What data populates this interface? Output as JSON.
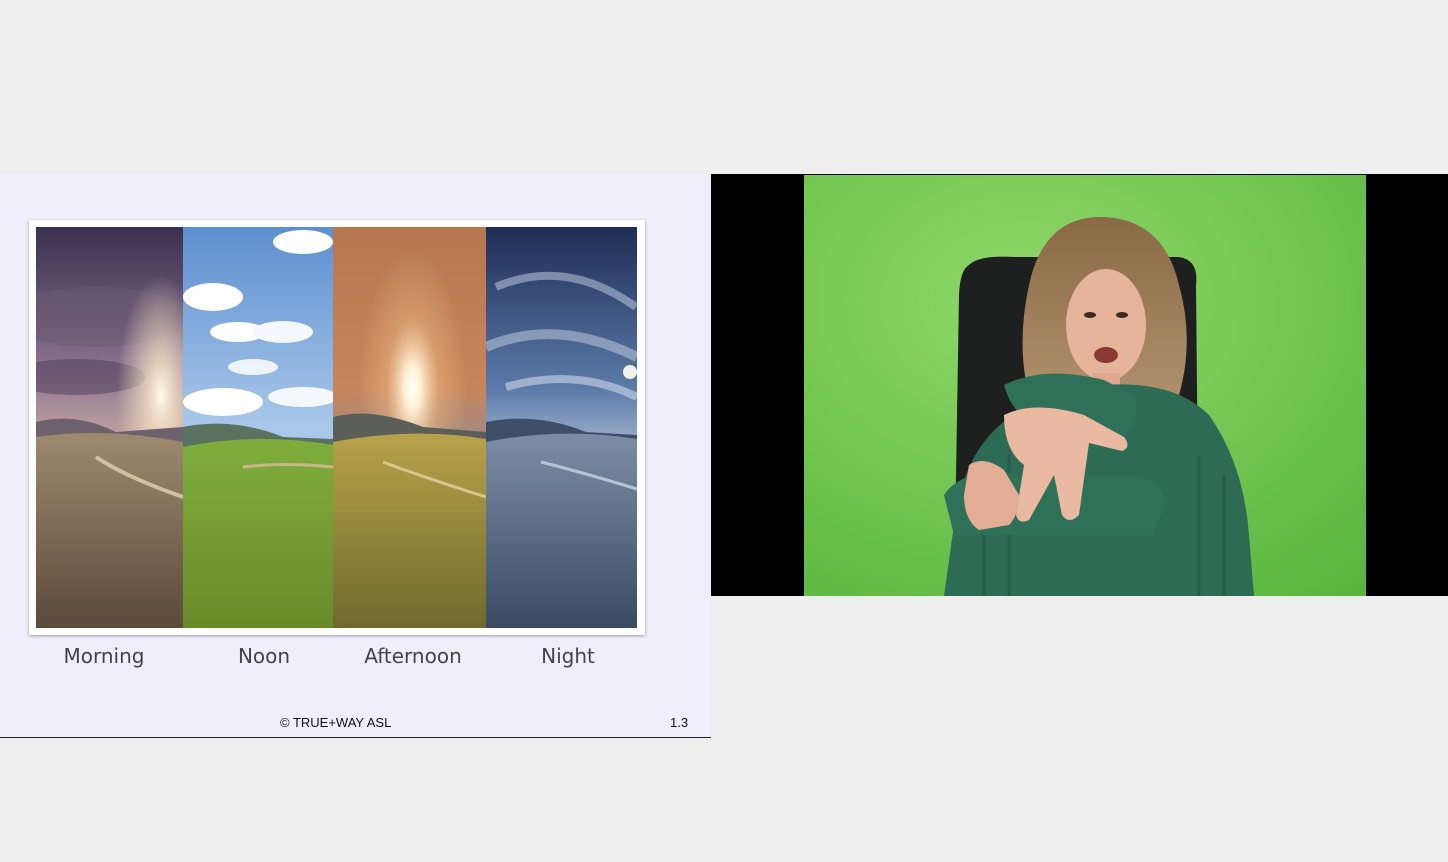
{
  "slide": {
    "labels": {
      "morning": "Morning",
      "noon": "Noon",
      "afternoon": "Afternoon",
      "night": "Night"
    },
    "copyright": "© TRUE+WAY ASL",
    "slide_number": "1.3"
  },
  "video": {
    "background": "green-screen",
    "subject": "signer"
  },
  "colors": {
    "page_bg": "#eeeeee",
    "slide_bg": "#f1eefc",
    "green_screen": "#6fcc4f",
    "sweater": "#2e6b55"
  }
}
